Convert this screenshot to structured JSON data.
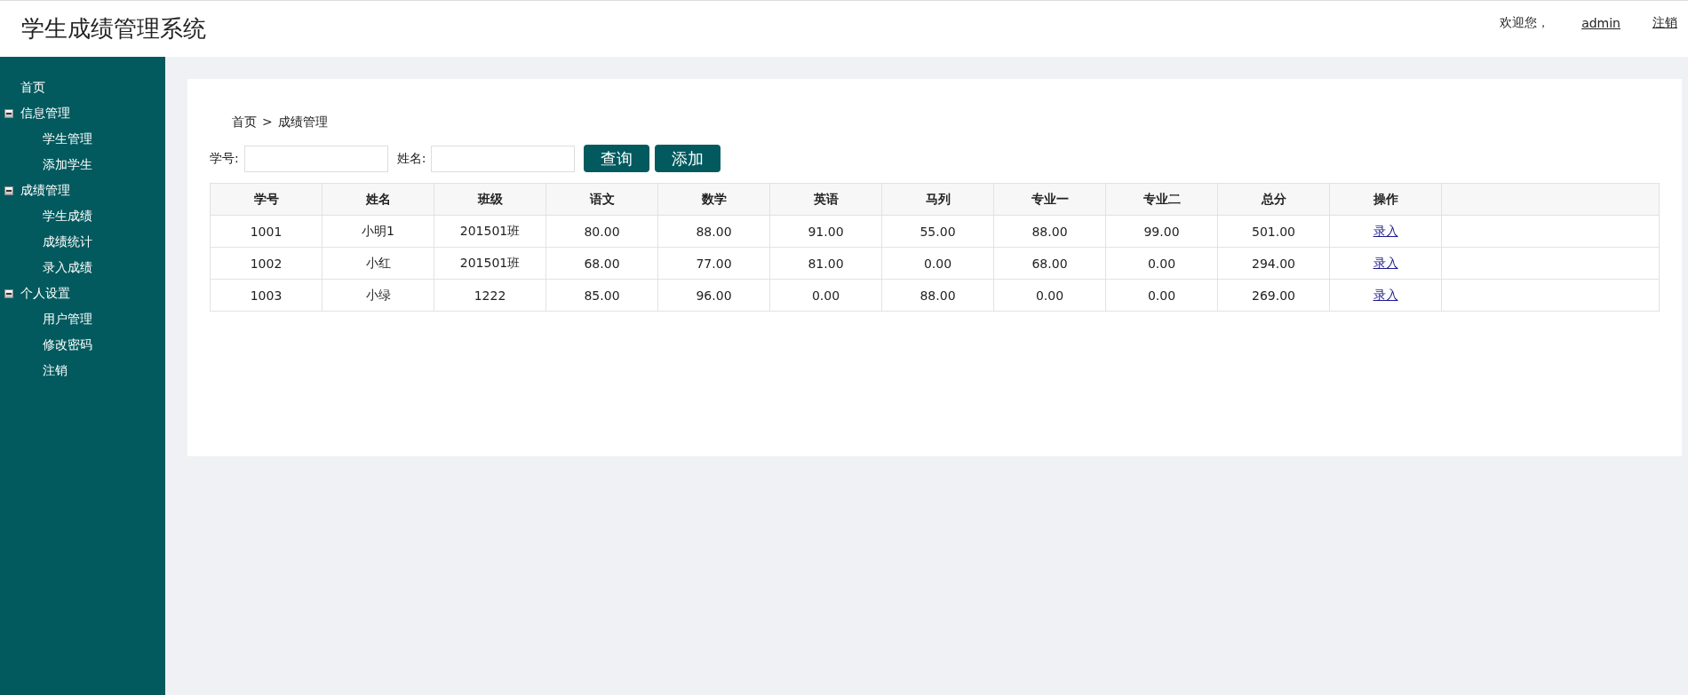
{
  "header": {
    "title": "学生成绩管理系统",
    "welcome": "欢迎您，",
    "user": "admin",
    "logout": "注销"
  },
  "sidebar": {
    "items": [
      {
        "label": "首页"
      },
      {
        "label": "信息管理",
        "expanded": true,
        "children": [
          {
            "label": "学生管理"
          },
          {
            "label": "添加学生"
          }
        ]
      },
      {
        "label": "成绩管理",
        "expanded": true,
        "children": [
          {
            "label": "学生成绩"
          },
          {
            "label": "成绩统计"
          },
          {
            "label": "录入成绩"
          }
        ]
      },
      {
        "label": "个人设置",
        "expanded": true,
        "children": [
          {
            "label": "用户管理"
          },
          {
            "label": "修改密码"
          },
          {
            "label": "注销"
          }
        ]
      }
    ]
  },
  "breadcrumb": {
    "home": "首页",
    "separator": ">",
    "current": "成绩管理"
  },
  "search": {
    "fields": [
      {
        "label": "学号:"
      },
      {
        "label": "姓名:"
      }
    ],
    "buttons": [
      "查询",
      "添加"
    ]
  },
  "table": {
    "columns": [
      "学号",
      "姓名",
      "班级",
      "语文",
      "数学",
      "英语",
      "马列",
      "专业一",
      "专业二",
      "总分",
      "操作"
    ],
    "rows": [
      {
        "cells": [
          "1001",
          "小明1",
          "201501班",
          "80.00",
          "88.00",
          "91.00",
          "55.00",
          "88.00",
          "99.00",
          "501.00"
        ],
        "action": "录入"
      },
      {
        "cells": [
          "1002",
          "小红",
          "201501班",
          "68.00",
          "77.00",
          "81.00",
          "0.00",
          "68.00",
          "0.00",
          "294.00"
        ],
        "action": "录入"
      },
      {
        "cells": [
          "1003",
          "小绿",
          "1222",
          "85.00",
          "96.00",
          "0.00",
          "88.00",
          "0.00",
          "0.00",
          "269.00"
        ],
        "action": "录入"
      }
    ]
  }
}
